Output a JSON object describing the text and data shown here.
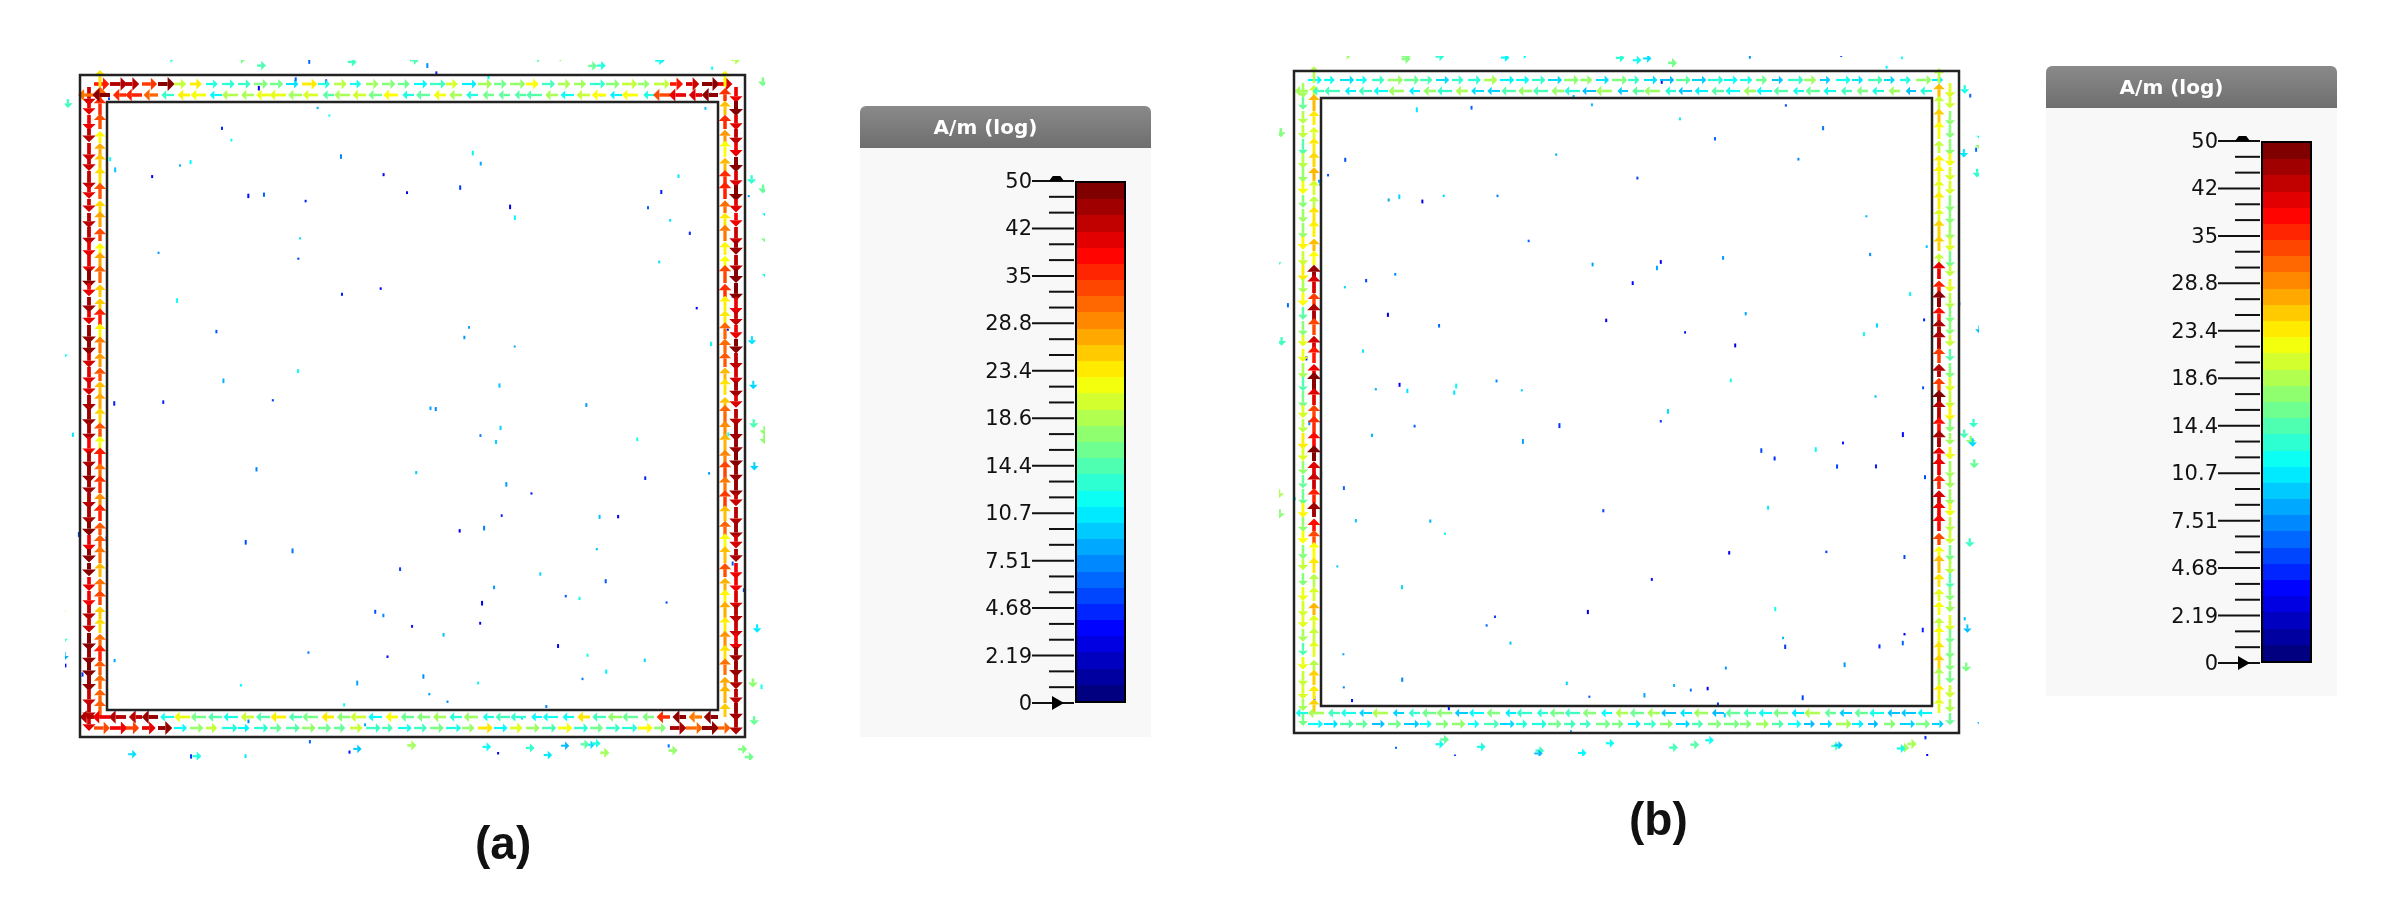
{
  "panels": [
    {
      "kind": "edges",
      "caption": "(a)",
      "legend": {
        "title": "A/m (log)",
        "ticks": [
          "50",
          "42",
          "35",
          "28.8",
          "23.4",
          "18.6",
          "14.4",
          "10.7",
          "7.51",
          "4.68",
          "2.19",
          "0"
        ]
      }
    },
    {
      "kind": "sides",
      "caption": "(b)",
      "legend": {
        "title": "A/m (log)",
        "ticks": [
          "50",
          "42",
          "35",
          "28.8",
          "23.4",
          "18.6",
          "14.4",
          "10.7",
          "7.51",
          "4.68",
          "2.19",
          "0"
        ]
      }
    }
  ]
}
